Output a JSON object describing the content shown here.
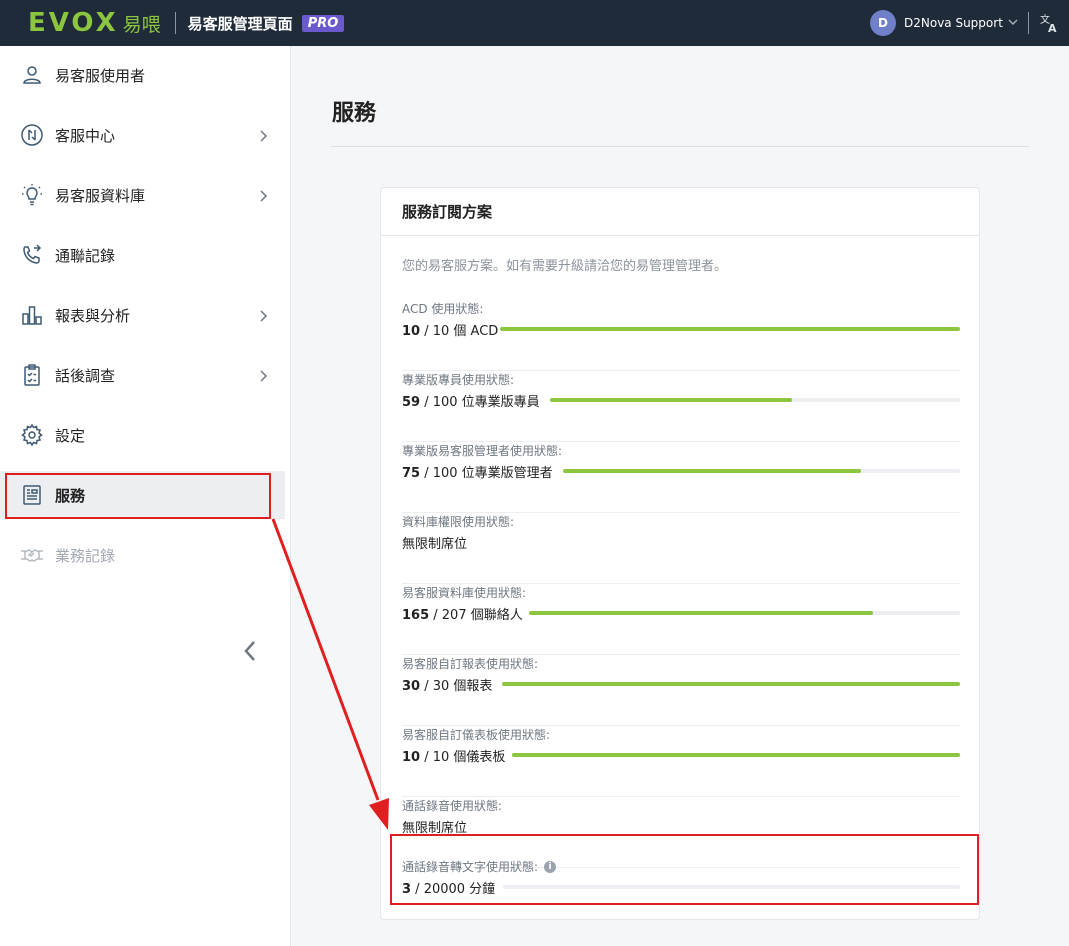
{
  "header": {
    "logo_text": "EVOX",
    "logo_cn": "易喂",
    "app_title": "易客服管理頁面",
    "pro_badge": "PRO",
    "user_initial": "D",
    "user_name": "D2Nova Support"
  },
  "sidebar": {
    "items": [
      {
        "label": "易客服使用者",
        "icon": "user-icon",
        "has_arrow": false
      },
      {
        "label": "客服中心",
        "icon": "contact-center-icon",
        "has_arrow": true
      },
      {
        "label": "易客服資料庫",
        "icon": "lightbulb-icon",
        "has_arrow": true
      },
      {
        "label": "通聯記錄",
        "icon": "call-log-icon",
        "has_arrow": false
      },
      {
        "label": "報表與分析",
        "icon": "bar-chart-icon",
        "has_arrow": true
      },
      {
        "label": "話後調查",
        "icon": "clipboard-icon",
        "has_arrow": true
      },
      {
        "label": "設定",
        "icon": "gear-icon",
        "has_arrow": false
      },
      {
        "label": "服務",
        "icon": "service-icon",
        "has_arrow": false,
        "active": true
      },
      {
        "label": "業務記錄",
        "icon": "handshake-icon",
        "has_arrow": false,
        "disabled": true
      }
    ]
  },
  "main": {
    "page_title": "服務",
    "card_title": "服務訂閱方案",
    "description": "您的易客服方案。如有需要升級請洽您的易管理管理者。",
    "rows": [
      {
        "label": "ACD 使用狀態:",
        "used": "10",
        "rest": " / 10 個 ACD",
        "fraction": 1.0,
        "bar": true
      },
      {
        "label": "專業版專員使用狀態:",
        "used": "59",
        "rest": " / 100 位專業版專員",
        "fraction": 0.59,
        "bar": true
      },
      {
        "label": "專業版易客服管理者使用狀態:",
        "used": "75",
        "rest": " / 100 位專業版管理者",
        "fraction": 0.75,
        "bar": true
      },
      {
        "label": "資料庫權限使用狀態:",
        "used": "",
        "rest": "無限制席位",
        "fraction": 0,
        "bar": false
      },
      {
        "label": "易客服資料庫使用狀態:",
        "used": "165",
        "rest": " / 207 個聯絡人",
        "fraction": 0.797,
        "bar": true
      },
      {
        "label": "易客服自訂報表使用狀態:",
        "used": "30",
        "rest": " / 30 個報表",
        "fraction": 1.0,
        "bar": true
      },
      {
        "label": "易客服自訂儀表板使用狀態:",
        "used": "10",
        "rest": " / 10 個儀表板",
        "fraction": 1.0,
        "bar": true
      },
      {
        "label": "通話錄音使用狀態:",
        "used": "",
        "rest": "無限制席位",
        "fraction": 0,
        "bar": false
      },
      {
        "label": "通話錄音轉文字使用狀態:",
        "used": "3",
        "rest": " / 20000 分鐘",
        "fraction": 0.00015,
        "bar": true,
        "info": true
      }
    ]
  },
  "colors": {
    "topbar_bg": "#1f2b38",
    "brand_green": "#8cc63f",
    "pro_purple": "#6a5acd",
    "highlight_red": "#e02020"
  }
}
